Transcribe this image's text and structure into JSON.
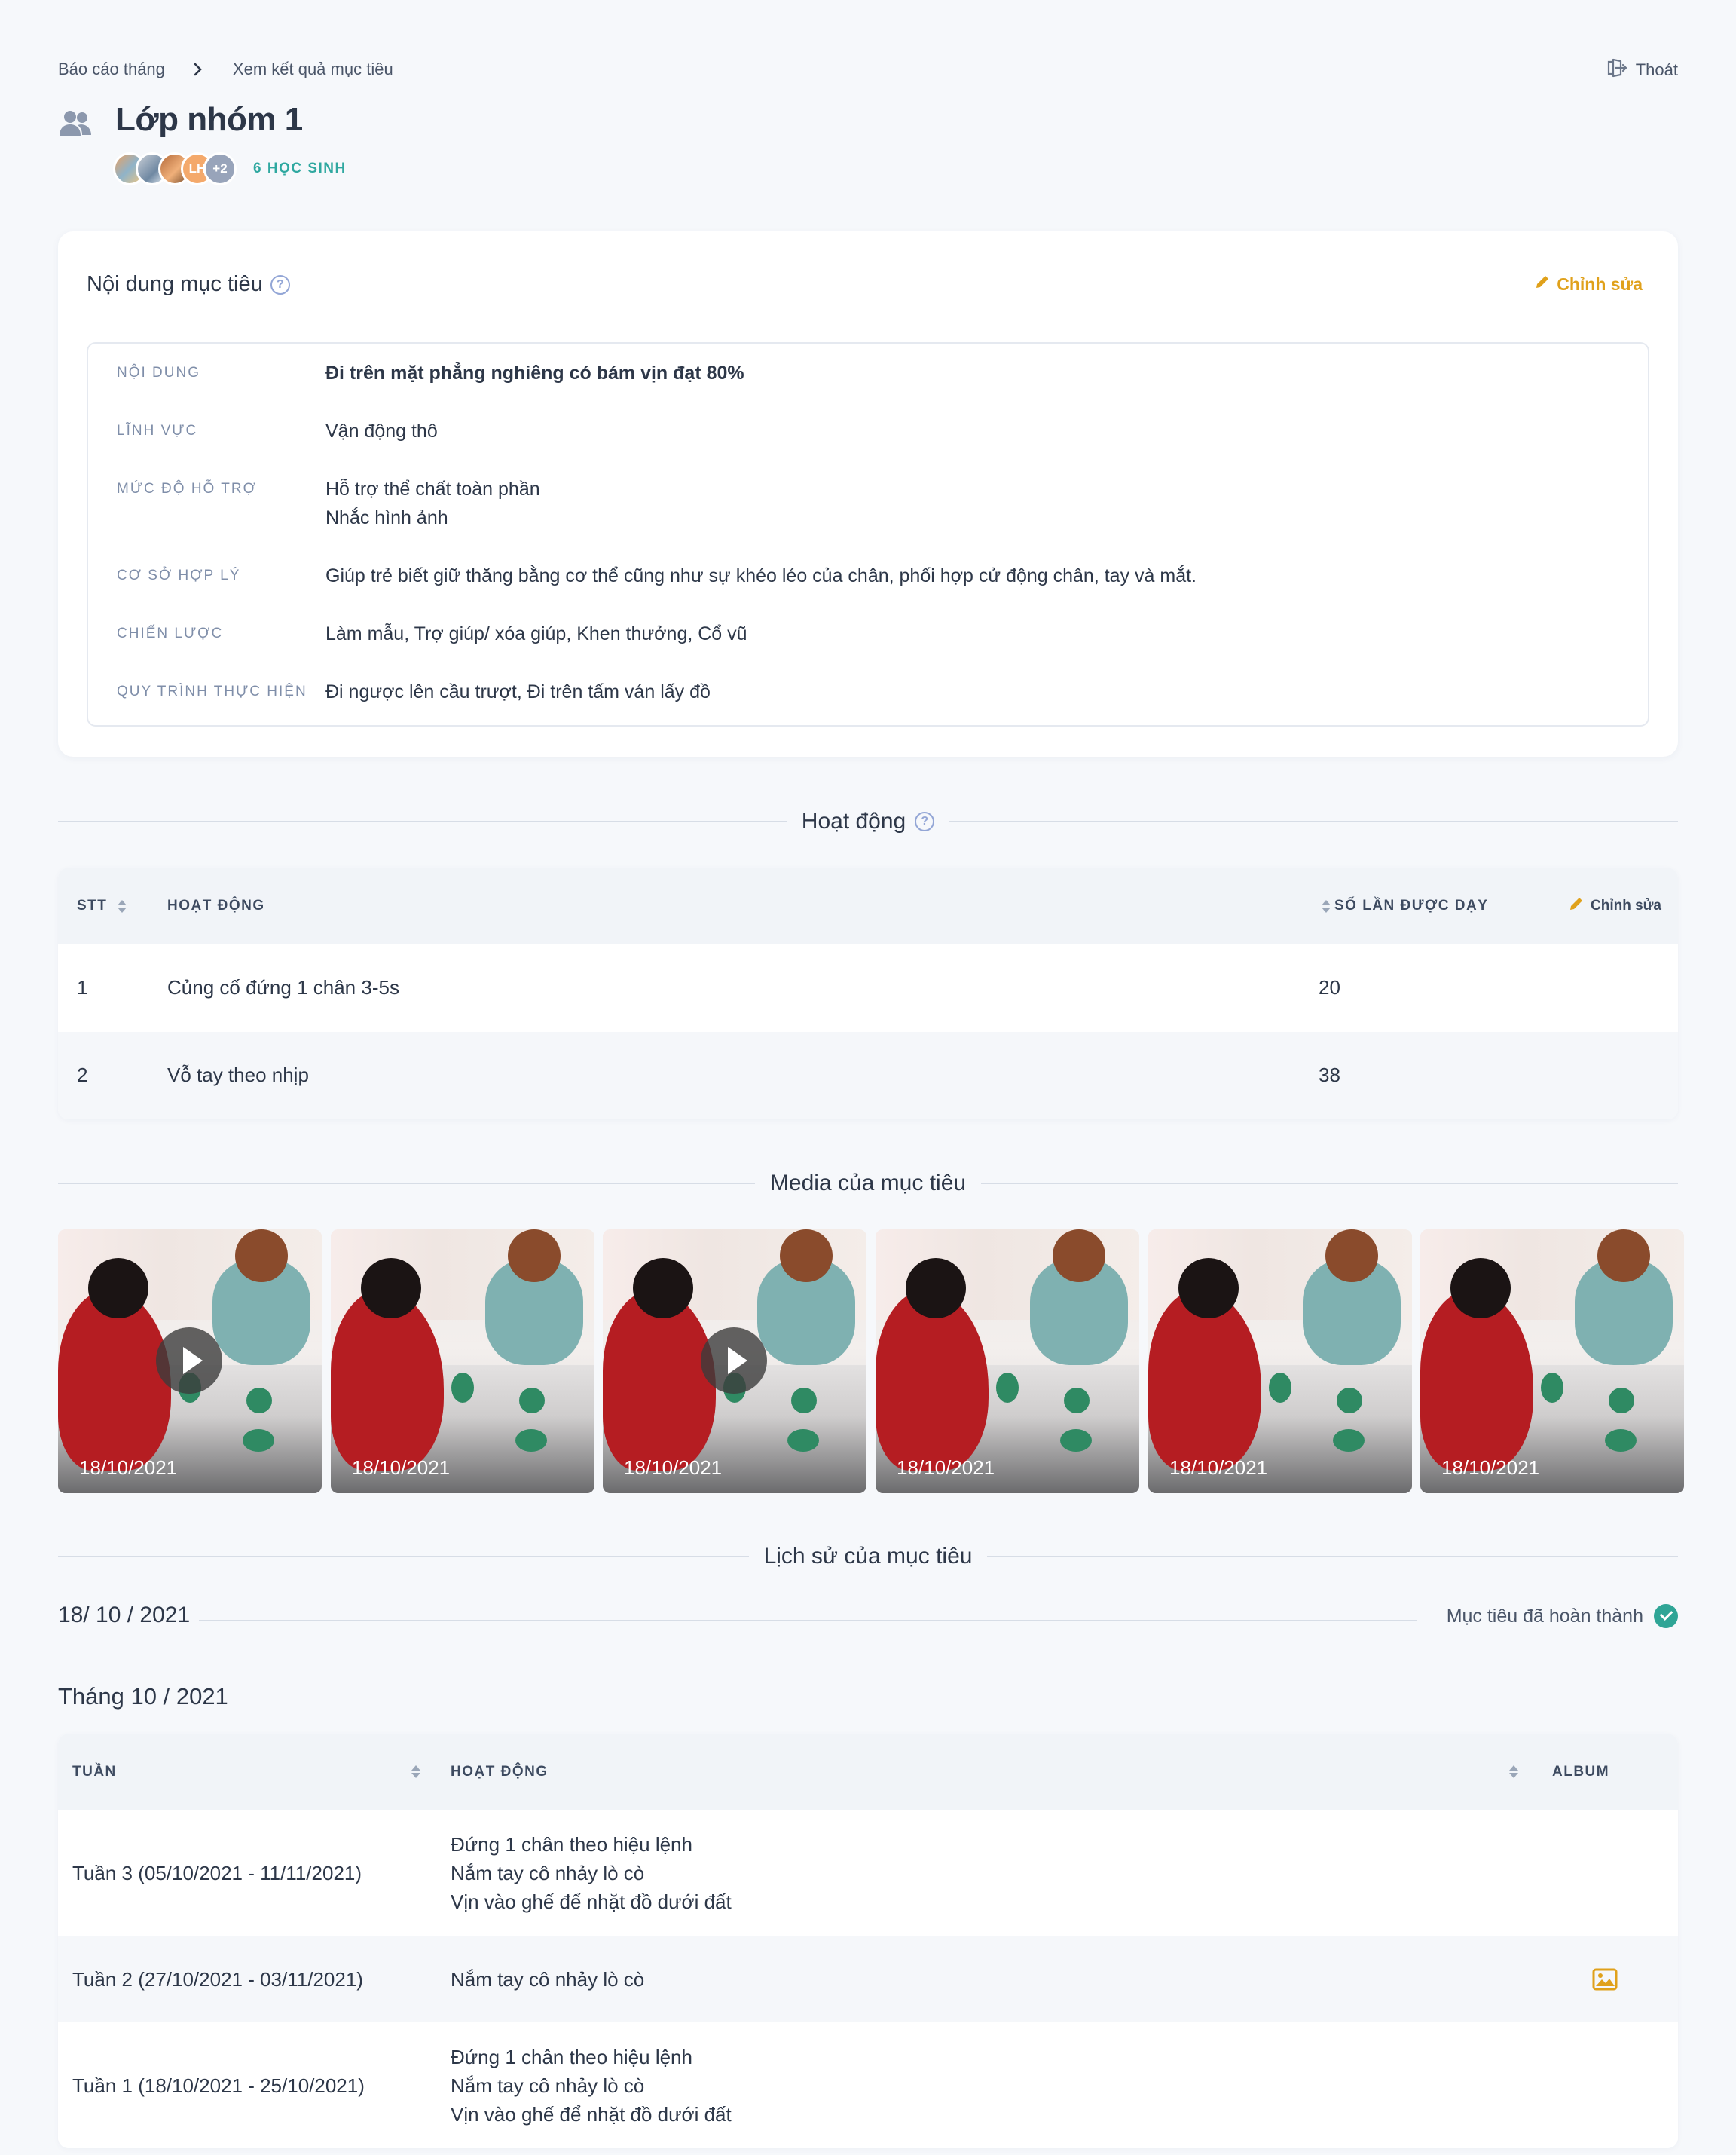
{
  "breadcrumb": {
    "parent": "Báo cáo tháng",
    "current": "Xem kết quả mục tiêu"
  },
  "header": {
    "logout_label": "Thoát",
    "title": "Lớp nhóm 1",
    "avatar_initials": "LH",
    "avatar_more": "+2",
    "student_count": "6 HỌC SINH"
  },
  "goal_card": {
    "title": "Nội dung mục tiêu",
    "edit_label": "Chỉnh sửa",
    "rows": [
      {
        "label": "NỘI DUNG",
        "value": "Đi trên mặt phẳng nghiêng có bám vịn đạt 80%"
      },
      {
        "label": "LĨNH VỰC",
        "value": "Vận động thô"
      },
      {
        "label": "MỨC ĐỘ HỖ TRỢ",
        "value": "Hỗ trợ thể chất toàn phần",
        "value2": "Nhắc hình ảnh"
      },
      {
        "label": "CƠ SỞ HỢP LÝ",
        "value": "Giúp trẻ biết giữ thăng bằng cơ thể cũng như sự khéo léo của chân, phối hợp cử động chân, tay và mắt."
      },
      {
        "label": "CHIẾN LƯỢC",
        "value": "Làm mẫu, Trợ giúp/ xóa giúp, Khen thưởng, Cổ vũ"
      },
      {
        "label": "QUY TRÌNH THỰC HIỆN",
        "value": "Đi ngược lên cầu trượt, Đi trên tấm ván lấy đồ"
      }
    ]
  },
  "activities": {
    "section_title": "Hoạt động",
    "headers": {
      "stt": "STT",
      "activity": "HOẠT ĐỘNG",
      "count": "SỐ LẦN ĐƯỢC DẠY"
    },
    "edit_label": "Chỉnh sửa",
    "rows": [
      {
        "stt": "1",
        "name": "Củng cố đứng 1 chân 3-5s",
        "count": "20"
      },
      {
        "stt": "2",
        "name": "Vỗ tay theo nhịp",
        "count": "38"
      }
    ]
  },
  "media": {
    "section_title": "Media của mục tiêu",
    "items": [
      {
        "date": "18/10/2021",
        "is_video": true
      },
      {
        "date": "18/10/2021",
        "is_video": false
      },
      {
        "date": "18/10/2021",
        "is_video": true
      },
      {
        "date": "18/10/2021",
        "is_video": false
      },
      {
        "date": "18/10/2021",
        "is_video": false
      },
      {
        "date": "18/10/2021",
        "is_video": false
      }
    ]
  },
  "history": {
    "section_title": "Lịch sử của mục tiêu",
    "date": "18/ 10 / 2021",
    "status": "Mục tiêu đã hoàn thành",
    "month_title": "Tháng 10 / 2021",
    "headers": {
      "week": "TUẦN",
      "activity": "HOẠT ĐỘNG",
      "album": "ALBUM"
    },
    "rows": [
      {
        "week": "Tuần 3 (05/10/2021 - 11/11/2021)",
        "activities": [
          "Đứng 1 chân theo hiệu lệnh",
          "Nắm tay cô nhảy lò cò",
          "Vịn vào ghế để nhặt đồ dưới đất"
        ],
        "album": false
      },
      {
        "week": "Tuần 2 (27/10/2021 - 03/11/2021)",
        "activities": [
          "Nắm tay cô nhảy lò cò"
        ],
        "album": true
      },
      {
        "week": "Tuần 1 (18/10/2021 - 25/10/2021)",
        "activities": [
          "Đứng 1 chân theo hiệu lệnh",
          "Nắm tay cô nhảy lò cò",
          "Vịn vào ghế để nhặt đồ dưới đất"
        ],
        "album": false
      }
    ]
  },
  "colors": {
    "accent_teal": "#2fa8a0",
    "edit_orange": "#e0a11b",
    "status_green": "#2fa596",
    "label_gray": "#7f8ea9"
  }
}
